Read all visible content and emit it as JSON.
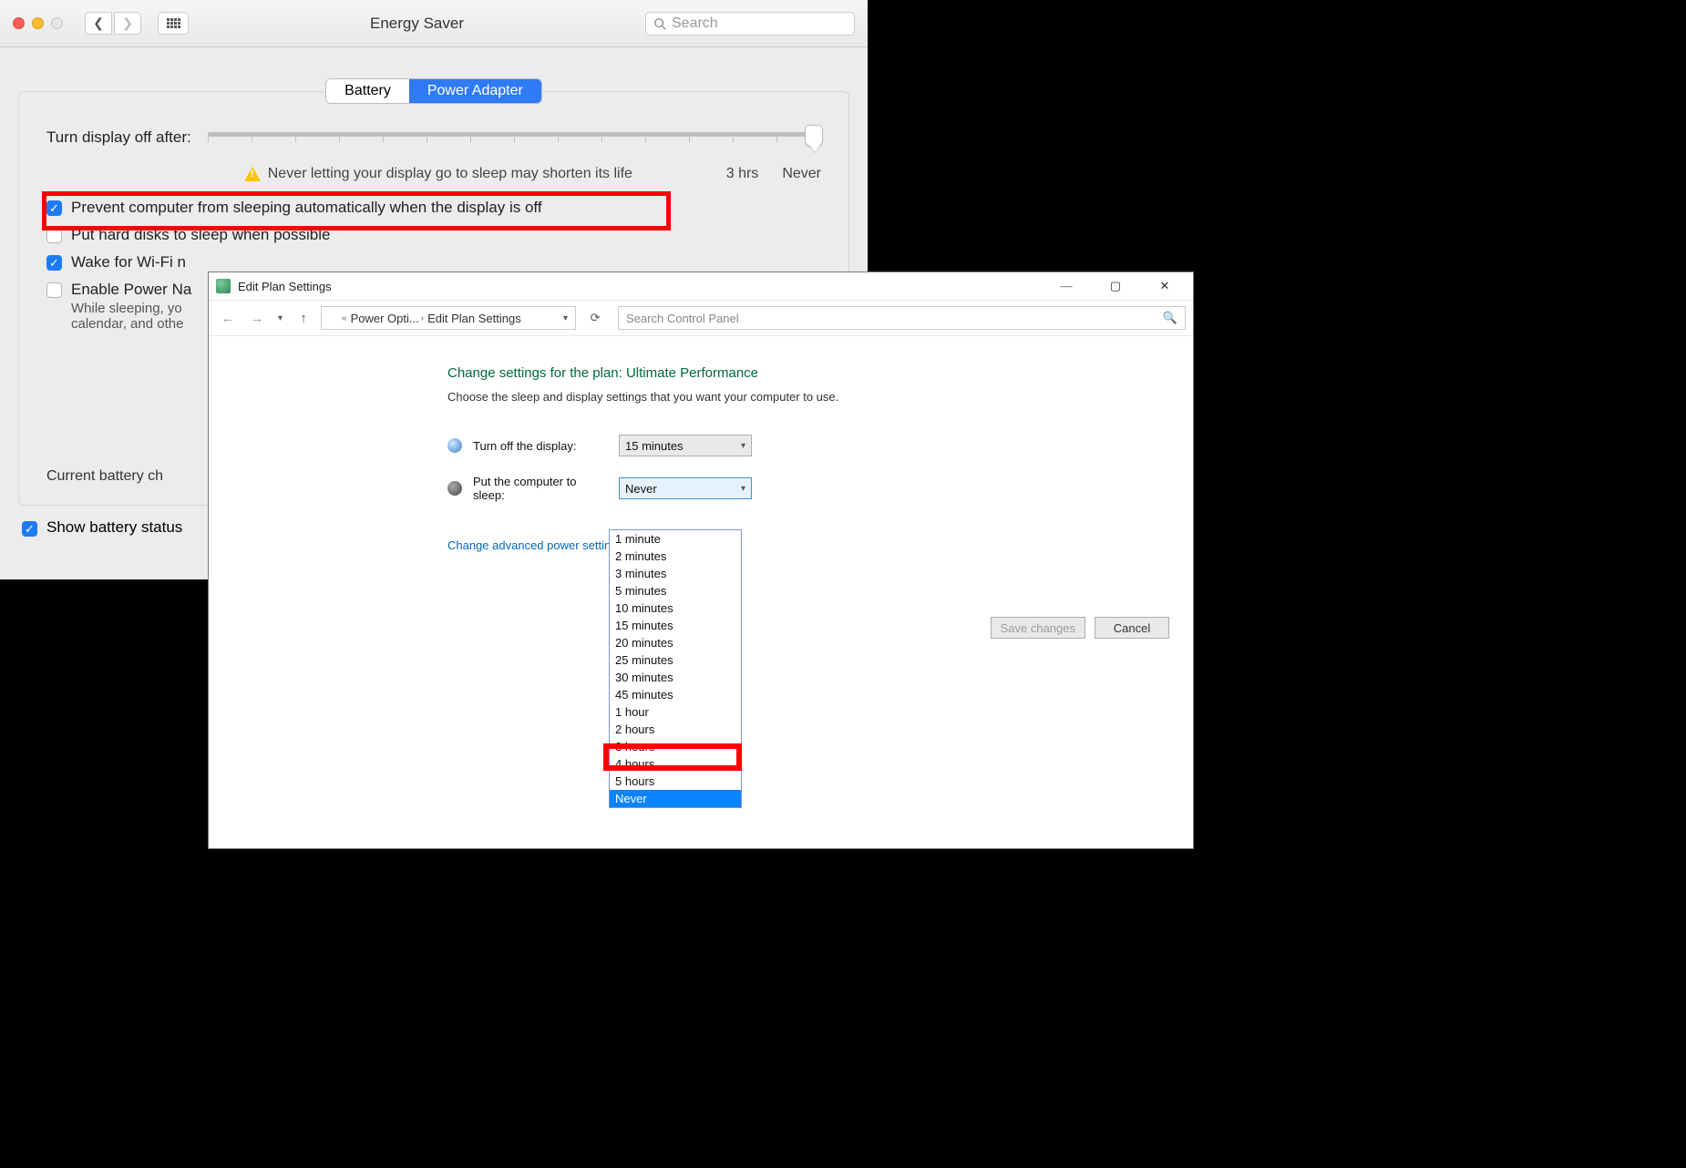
{
  "mac": {
    "title": "Energy Saver",
    "search_placeholder": "Search",
    "tabs": {
      "battery": "Battery",
      "power_adapter": "Power Adapter"
    },
    "slider": {
      "label": "Turn display off after:",
      "warning": "Never letting your display go to sleep may shorten its life",
      "mark_3hrs": "3 hrs",
      "mark_never": "Never"
    },
    "options": {
      "prevent_sleep": {
        "label": "Prevent computer from sleeping automatically when the display is off",
        "checked": true,
        "highlighted": true
      },
      "hard_disks": {
        "label": "Put hard disks to sleep when possible",
        "checked": false
      },
      "wake_wifi": {
        "label": "Wake for Wi-Fi n",
        "checked": true
      },
      "power_nap": {
        "label": "Enable Power Na",
        "checked": false,
        "sub": "While sleeping, yo\ncalendar, and othe"
      }
    },
    "battery_charge": "Current battery ch",
    "footer": {
      "show_status": "Show battery status",
      "checked": true
    }
  },
  "win": {
    "title": "Edit Plan Settings",
    "breadcrumb": {
      "level1": "Power Opti...",
      "level2": "Edit Plan Settings"
    },
    "search_placeholder": "Search Control Panel",
    "heading": "Change settings for the plan: Ultimate Performance",
    "subheading": "Choose the sleep and display settings that you want your computer to use.",
    "turn_off_display": {
      "label": "Turn off the display:",
      "value": "15 minutes"
    },
    "put_to_sleep": {
      "label": "Put the computer to sleep:",
      "value": "Never"
    },
    "advanced_link": "Change advanced power settings",
    "buttons": {
      "save": "Save changes",
      "cancel": "Cancel"
    },
    "sleep_options": [
      "1 minute",
      "2 minutes",
      "3 minutes",
      "5 minutes",
      "10 minutes",
      "15 minutes",
      "20 minutes",
      "25 minutes",
      "30 minutes",
      "45 minutes",
      "1 hour",
      "2 hours",
      "3 hours",
      "4 hours",
      "5 hours",
      "Never"
    ],
    "sleep_selected": "Never"
  }
}
